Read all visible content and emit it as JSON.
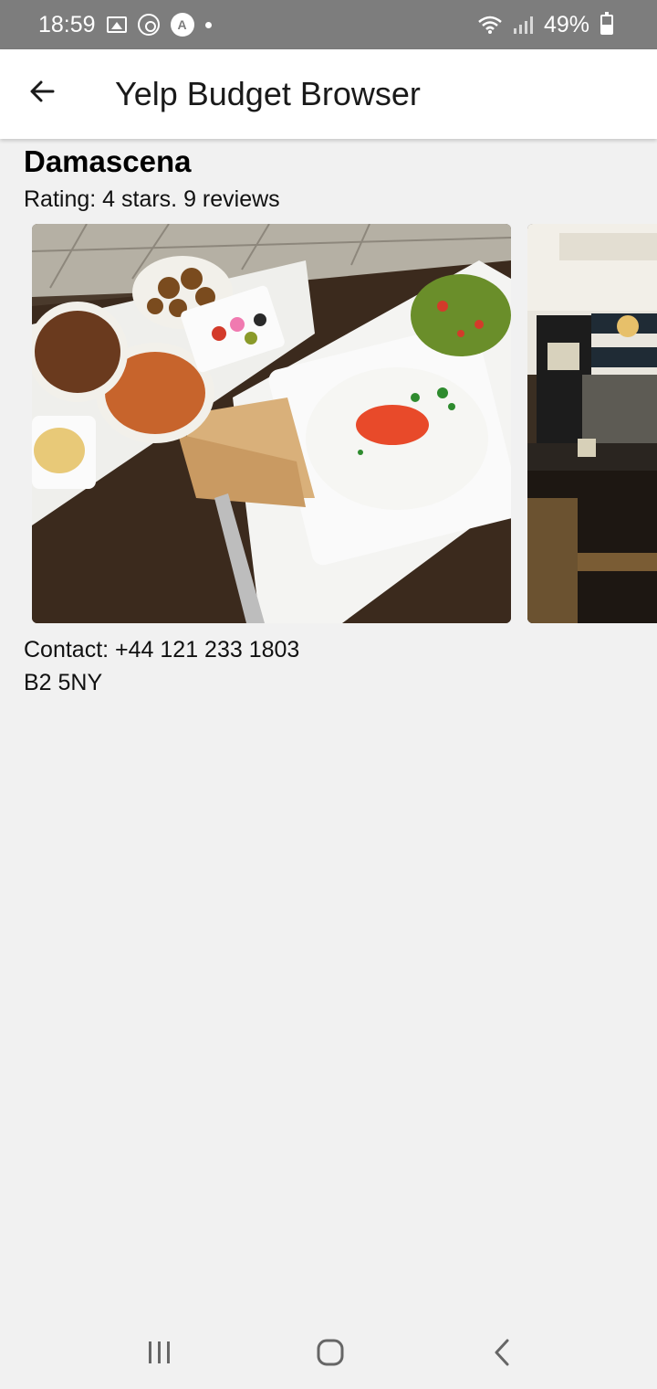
{
  "status_bar": {
    "time": "18:59",
    "battery_text": "49%",
    "battery_level": 0.49,
    "notification_icons": [
      "gallery-icon",
      "whatsapp-icon",
      "app-icon",
      "dot-icon"
    ],
    "app_icon_letter": "A",
    "system_icons": [
      "wifi-icon",
      "signal-icon",
      "battery-icon"
    ]
  },
  "app_bar": {
    "back_icon": "arrow-back-icon",
    "title": "Yelp Budget Browser"
  },
  "restaurant": {
    "name": "Damascena",
    "rating_text": "Rating: 4 stars. 9 reviews",
    "photos": [
      {
        "description_icon": "food-platter-photo"
      },
      {
        "description_icon": "restaurant-interior-photo"
      }
    ],
    "contact_text": "Contact: +44 121 233 1803",
    "postcode": "B2 5NY"
  },
  "nav_bar": {
    "items": [
      "recents-icon",
      "home-icon",
      "back-icon"
    ]
  },
  "colors": {
    "status_bar_bg": "#7d7d7d",
    "app_bar_bg": "#ffffff",
    "page_bg": "#f1f1f1",
    "text": "#111111"
  }
}
